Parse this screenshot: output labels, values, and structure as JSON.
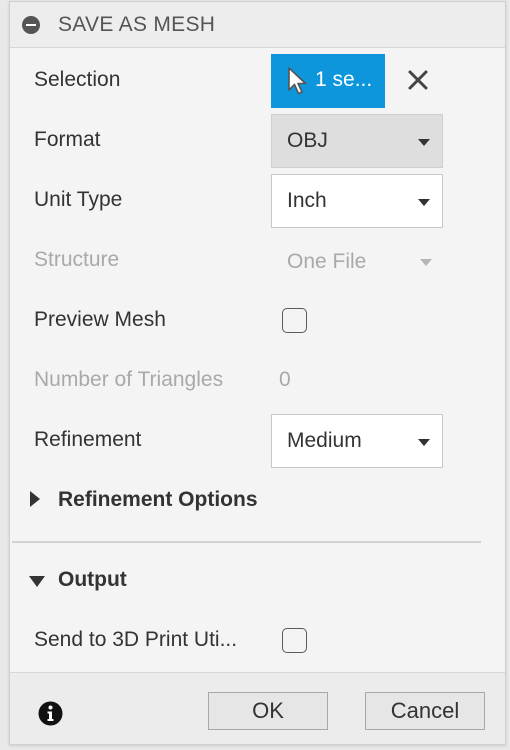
{
  "dialog": {
    "title": "SAVE AS MESH"
  },
  "rows": {
    "selection": {
      "label": "Selection",
      "value": "1 se..."
    },
    "format": {
      "label": "Format",
      "value": "OBJ"
    },
    "unit_type": {
      "label": "Unit Type",
      "value": "Inch"
    },
    "structure": {
      "label": "Structure",
      "value": "One File"
    },
    "preview_mesh": {
      "label": "Preview Mesh",
      "checked": false
    },
    "triangles": {
      "label": "Number of Triangles",
      "value": "0"
    },
    "refinement": {
      "label": "Refinement",
      "value": "Medium"
    }
  },
  "sections": {
    "refinement_options": "Refinement Options",
    "output": "Output"
  },
  "output": {
    "send_to_print": {
      "label": "Send to 3D Print Uti...",
      "checked": false
    }
  },
  "footer": {
    "ok_label": "OK",
    "cancel_label": "Cancel"
  },
  "colors": {
    "accent": "#0d96dc",
    "panel": "#f4f4f4",
    "disabled_text": "#a9a9a9"
  }
}
